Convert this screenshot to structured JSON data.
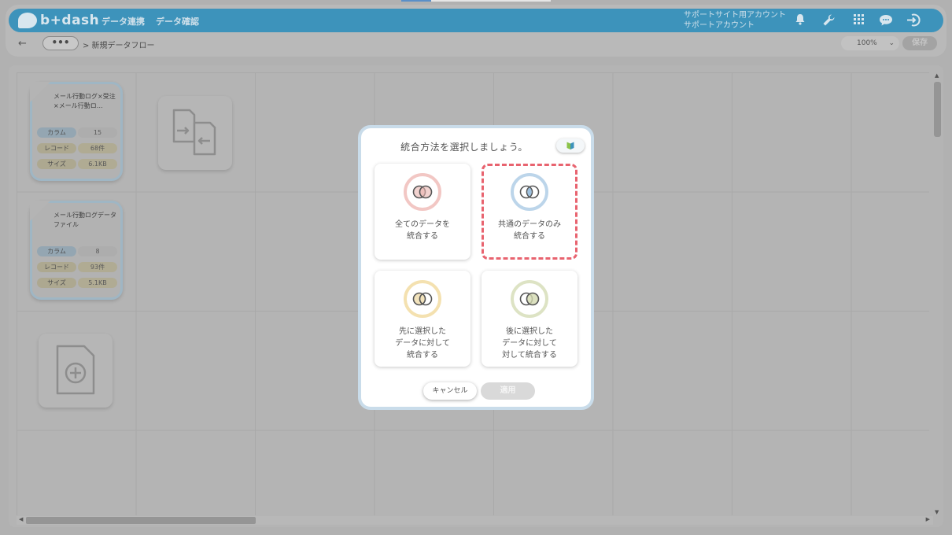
{
  "app": {
    "logo_text": "b+dash",
    "nav": [
      "データ連携",
      "データ確認"
    ],
    "account_lines": [
      "サポートサイト用アカウント",
      "サポートアカウント"
    ]
  },
  "toolbar": {
    "breadcrumb": "> 新規データフロー",
    "dots_label": "•••",
    "zoom": "100%",
    "save_label": "保存"
  },
  "nodes": [
    {
      "title": "メール行動ログ×受注×メール行動ロ…",
      "rows": [
        {
          "key": "カラム",
          "value": "15"
        },
        {
          "key": "レコード",
          "value": "68件"
        },
        {
          "key": "サイズ",
          "value": "6.1KB"
        }
      ]
    },
    {
      "title": "メール行動ログデータファイル",
      "rows": [
        {
          "key": "カラム",
          "value": "8"
        },
        {
          "key": "レコード",
          "value": "93件"
        },
        {
          "key": "サイズ",
          "value": "5.1KB"
        }
      ]
    }
  ],
  "modal": {
    "title": "統合方法を選択しましょう。",
    "options": [
      {
        "label_lines": [
          "全てのデータを",
          "統合する"
        ],
        "color": "#f2c7c4",
        "selected": false
      },
      {
        "label_lines": [
          "共通のデータのみ",
          "統合する"
        ],
        "color": "#bcd5ea",
        "selected": true
      },
      {
        "label_lines": [
          "先に選択した",
          "データに対して",
          "統合する"
        ],
        "color": "#f4e1b0",
        "selected": false
      },
      {
        "label_lines": [
          "後に選択した",
          "データに対して",
          "対して統合する"
        ],
        "color": "#dde3c4",
        "selected": false
      }
    ],
    "cancel_label": "キャンセル",
    "apply_label": "適用"
  },
  "colors": {
    "header": "#3d93bb",
    "selected_border": "#e8636f",
    "overlay": "#b1b1b1"
  }
}
